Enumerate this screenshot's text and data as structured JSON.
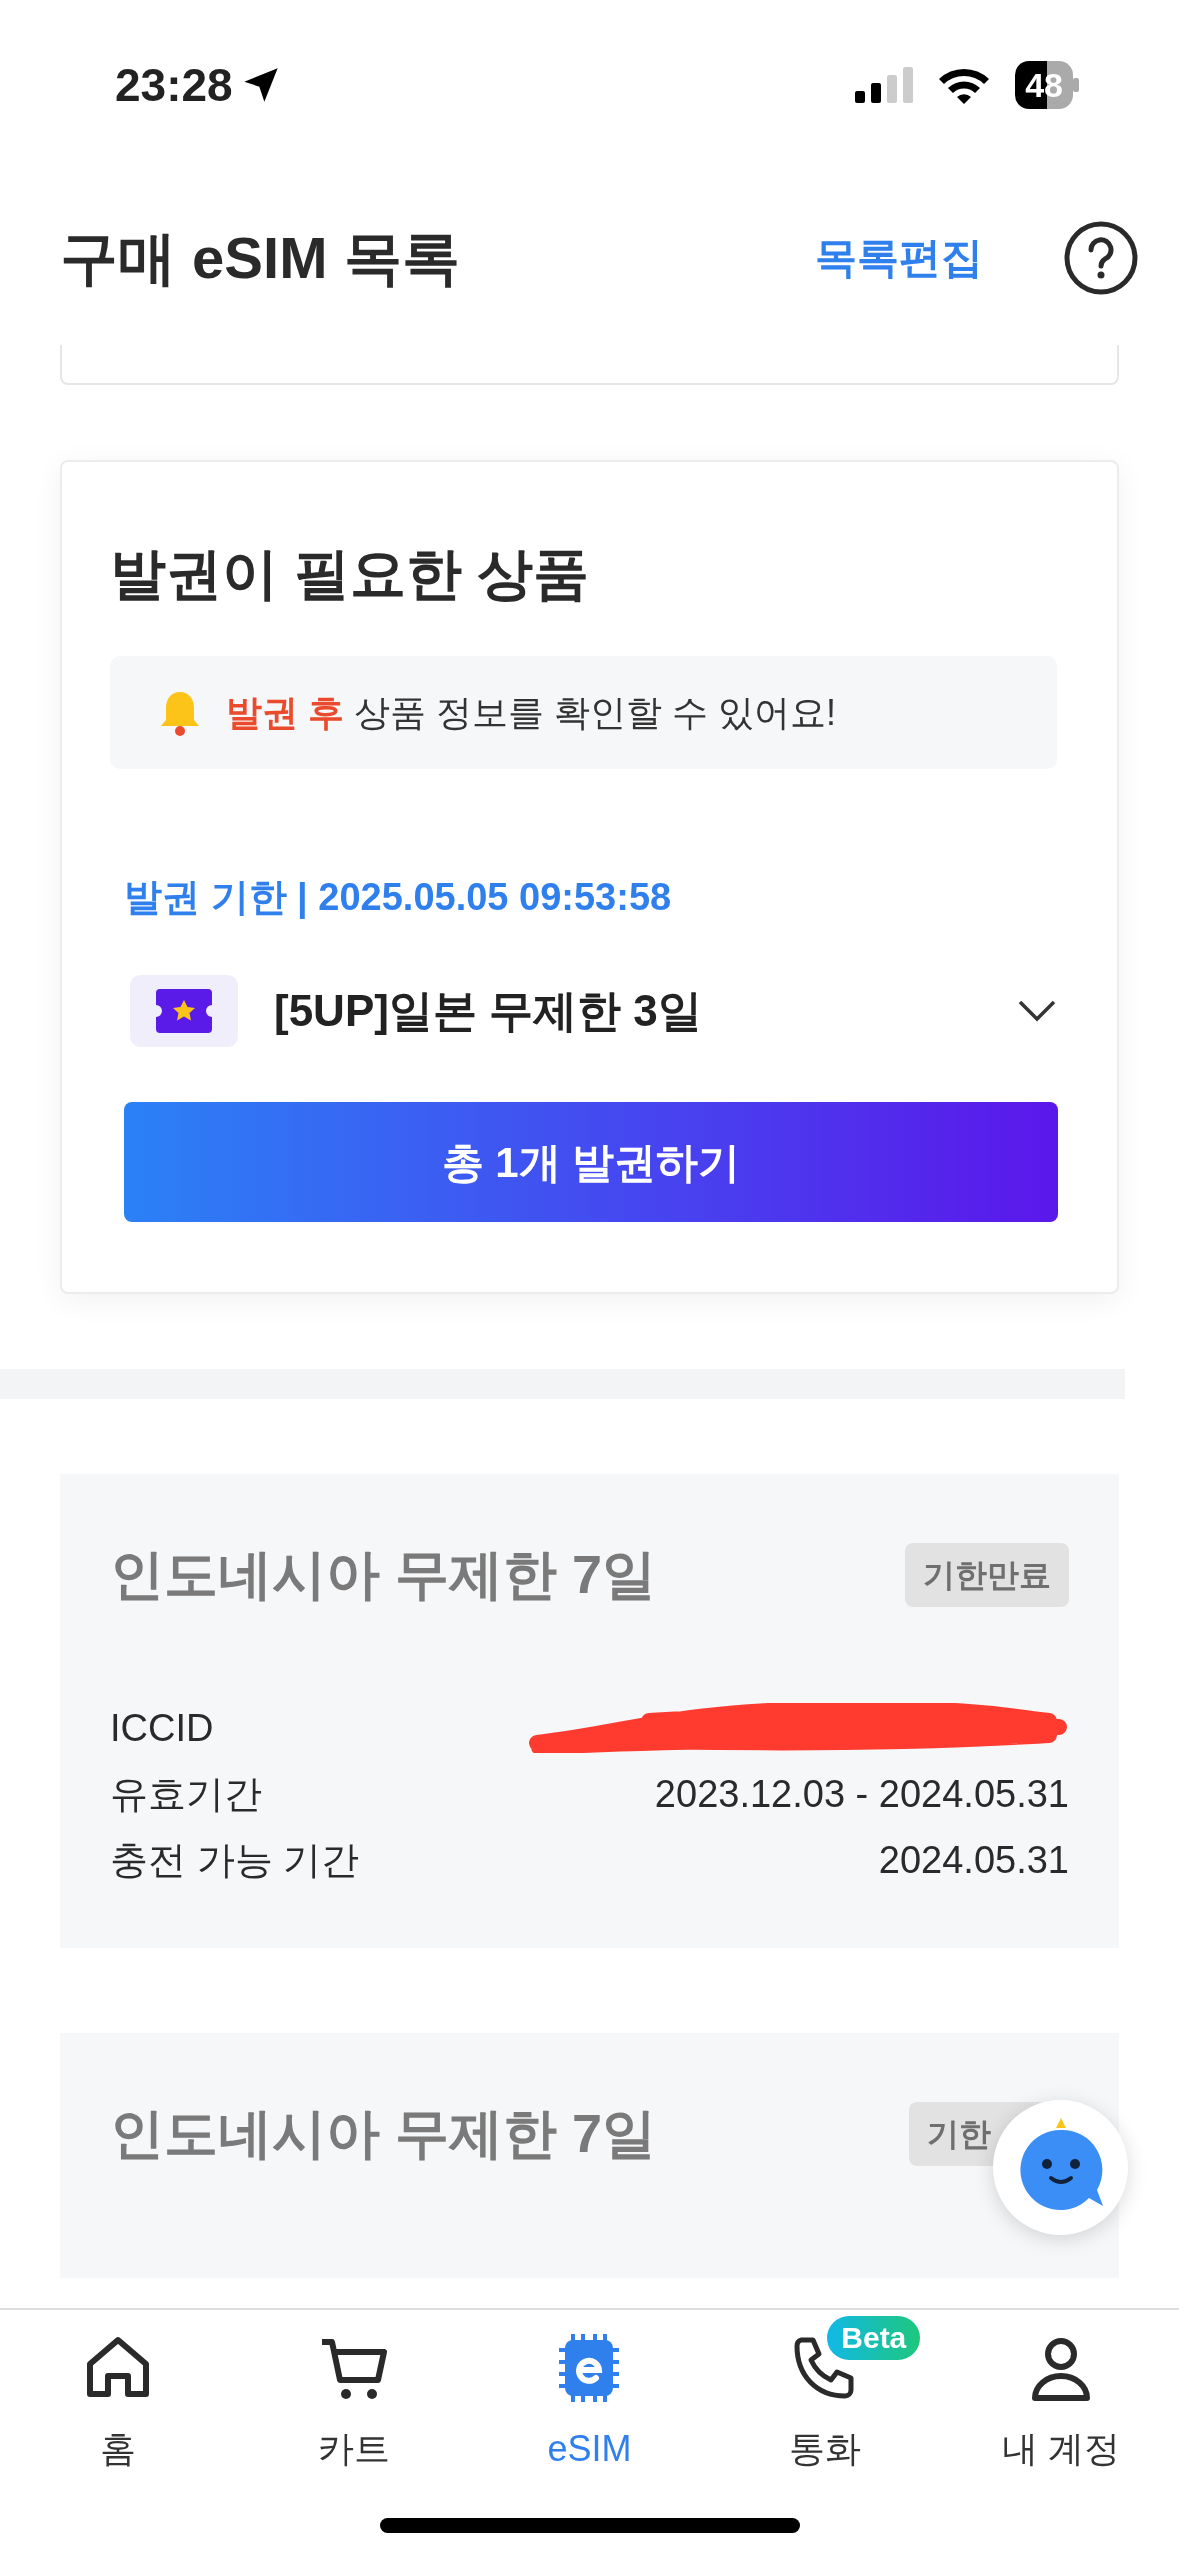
{
  "status_bar": {
    "time": "23:28",
    "battery": "48"
  },
  "header": {
    "title": "구매 eSIM 목록",
    "edit_link": "목록편집"
  },
  "issue_card": {
    "title": "발권이 필요한 상품",
    "notice": "**발권 후** 상품 정보를 확인할 수 있어요!",
    "deadline": "발권 기한 | 2025.05.05 09:53:58",
    "product": "[5UP]일본 무제한 3일",
    "expanded": false,
    "button": "총 1개 발권하기"
  },
  "esims": [
    {
      "title": "인도네시아 무제한 7일",
      "badge": "기한만료",
      "iccid_redacted": true,
      "rows": [
        {
          "label": "ICCID",
          "value": ""
        },
        {
          "label": "유효기간",
          "value": "2023.12.03 - 2024.05.31"
        },
        {
          "label": "충전 가능 기간",
          "value": "2024.05.31"
        }
      ]
    },
    {
      "title": "인도네시아 무제한 7일",
      "badge": "기한"
    }
  ],
  "tab_bar": [
    {
      "label": "홈",
      "kind": "home",
      "selected": false
    },
    {
      "label": "카트",
      "kind": "cart",
      "selected": false
    },
    {
      "label": "eSIM",
      "kind": "esim",
      "selected": true
    },
    {
      "label": "통화",
      "kind": "call",
      "selected": false,
      "badge": "Beta"
    },
    {
      "label": "내 계정",
      "kind": "account",
      "selected": false
    }
  ]
}
